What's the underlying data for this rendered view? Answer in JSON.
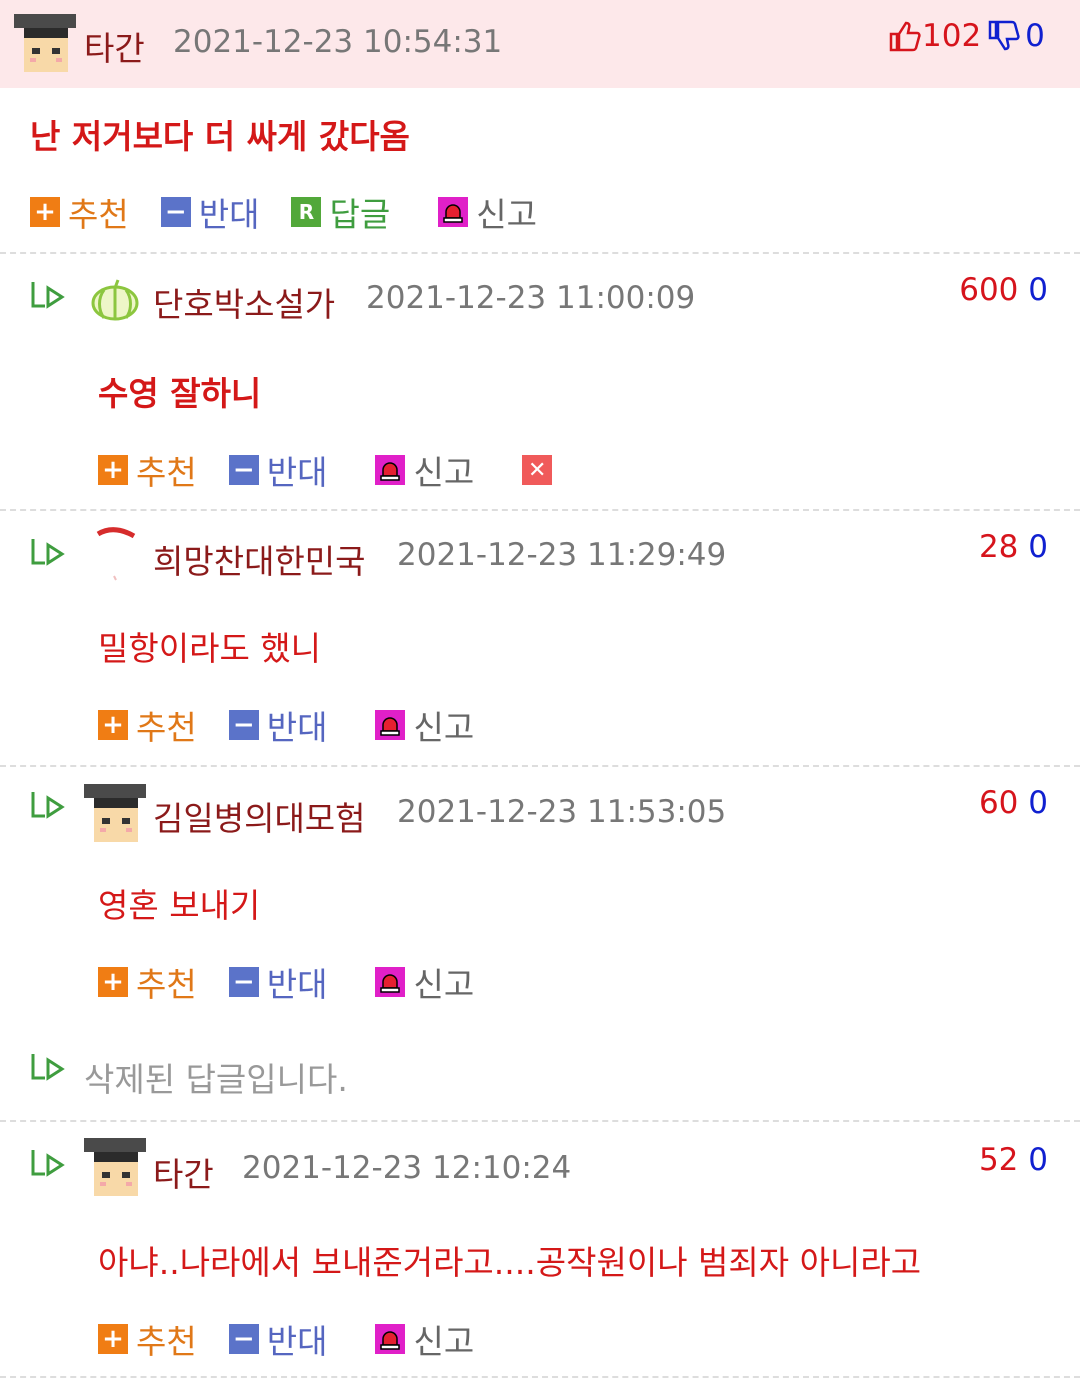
{
  "main_comment": {
    "author": "타간",
    "date": "2021-12-23 10:54:31",
    "up": "102",
    "down": "0",
    "body": "난 저거보다 더 싸게 갔다옴"
  },
  "actions": {
    "recommend": "추천",
    "oppose": "반대",
    "reply": "답글",
    "report": "신고"
  },
  "replies": [
    {
      "author": "단호박소설가",
      "date": "2021-12-23 11:00:09",
      "up": "600",
      "down": "0",
      "body": "수영 잘하니"
    },
    {
      "author": "희망찬대한민국",
      "date": "2021-12-23 11:29:49",
      "up": "28",
      "down": "0",
      "body": "밀항이라도 했니"
    },
    {
      "author": "김일병의대모험",
      "date": "2021-12-23 11:53:05",
      "up": "60",
      "down": "0",
      "body": "영혼 보내기"
    },
    {
      "author": "타간",
      "date": "2021-12-23 12:10:24",
      "up": "52",
      "down": "0",
      "body": "아냐..나라에서 보내준거라고....공작원이나 범죄자 아니라고"
    }
  ],
  "deleted_reply": "삭제된 답글입니다.",
  "icons": {
    "thumbs_up": "thumbs-up-icon",
    "thumbs_down": "thumbs-down-icon",
    "reply_arrow": "reply-arrow-icon",
    "avatar_student": "student-avatar-icon",
    "avatar_pumpkin": "pumpkin-icon"
  },
  "colors": {
    "header_bg": "#fde8ea",
    "author": "#8b1a1a",
    "body_text": "#d41818",
    "upvote": "#d6141c",
    "downvote": "#1020d0"
  }
}
